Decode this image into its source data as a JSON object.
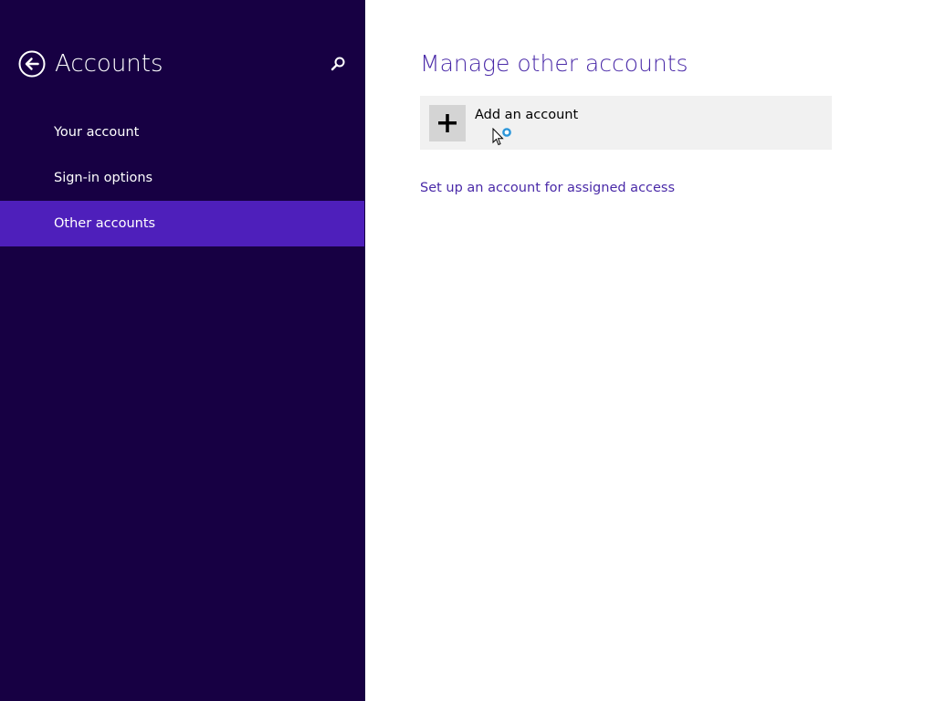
{
  "sidebar": {
    "title": "Accounts",
    "back_icon": "back-arrow-icon",
    "search_icon": "search-icon",
    "background_color": "#170043",
    "selected_color": "#4e1fbb",
    "items": [
      {
        "label": "Your account",
        "selected": false
      },
      {
        "label": "Sign-in options",
        "selected": false
      },
      {
        "label": "Other accounts",
        "selected": true
      }
    ]
  },
  "main": {
    "title": "Manage other accounts",
    "add_account": {
      "label": "Add an account",
      "icon": "plus-icon"
    },
    "assigned_access_link": "Set up an account for assigned access",
    "accent_color": "#4a2aa8"
  },
  "cursor": {
    "icon": "busy-pointer-icon"
  }
}
